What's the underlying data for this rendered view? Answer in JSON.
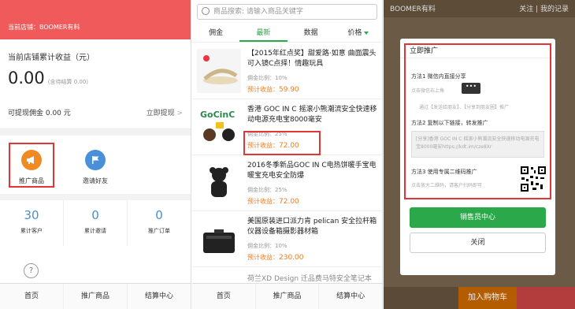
{
  "panel1": {
    "store_label": "当前店铺：BOOMER有料",
    "earn_label": "当前店铺累计收益（元）",
    "earn_amount": "0.00",
    "earn_note": "(含待结算 0.00)",
    "withdrawable": "可提现佣金 0.00 元",
    "withdraw_link": "立即提现",
    "withdraw_chevron": ">",
    "promote_label": "推广商品",
    "invite_label": "邀请好友",
    "promote_icon": "megaphone-icon",
    "invite_icon": "flag-icon",
    "stats": [
      {
        "num": "30",
        "label": "累计客户"
      },
      {
        "num": "0",
        "label": "累计邀请"
      },
      {
        "num": "0",
        "label": "推广订单"
      }
    ],
    "help_glyph": "?",
    "tabs": [
      "首页",
      "推广商品",
      "结算中心"
    ],
    "colors": {
      "header": "#f05a5a",
      "stat": "#4a90c8",
      "highlight": "#e23535"
    }
  },
  "panel2": {
    "search_placeholder": "商品搜索: 请输入商品关键字",
    "tabs": [
      "佣金",
      "最新",
      "数据",
      "价格"
    ],
    "active_tab": "最新",
    "items": [
      {
        "title": "【2015年红点奖】甜爱路·如意 曲面震头可入镜C点择！情趣玩具",
        "ratio": "佣金比例：10%",
        "income_label": "预计收益：",
        "income": "59.90"
      },
      {
        "title": "香港 GOC IN C 摇滚小熊潮流安全快速移动电源充电宝8000毫安",
        "ratio": "佣金比例：25%",
        "income_label": "预计收益：",
        "income": "72.00"
      },
      {
        "title": "2016冬季新品GOC IN C电热饼暖手宝电暖宝充电安全防爆",
        "ratio": "佣金比例：25%",
        "income_label": "预计收益：",
        "income": "72.00"
      },
      {
        "title": "美国原装进口派力肯 pelican 安全拉杆箱仪器设备箱摄影器材箱",
        "ratio": "佣金比例：10%",
        "income_label": "预计收益：",
        "income": "230.00"
      },
      {
        "title": "荷兰XD Design 迁品费马特安全笔记本双",
        "ratio": "",
        "income_label": "",
        "income": ""
      }
    ],
    "tabs_bottom": [
      "首页",
      "推广商品",
      "结算中心"
    ],
    "colors": {
      "accent": "#2aa84a",
      "income": "#f07a1e"
    }
  },
  "panel3": {
    "bg_title": "BOOMER有料",
    "bg_links": [
      "关注",
      "我的记录"
    ],
    "modal_title": "立即推广",
    "method1": "方法1 微信内直接分享",
    "method1_hint": "点击微信右上角",
    "more_glyph": "•••",
    "method1_hint2": "通过【发送给朋友】、【分享到朋友圈】推广",
    "method2": "方法2 复制以下链接，转发推广",
    "copy_text": "[分享]香港 GOC IN C 摇滚小熊潮流安全快速移动电源充电宝8000毫安https://kdt.im/cze8Xr",
    "method3": "方法3 使用专属二维码推广",
    "method3_hint": "点击放大二维码，请客户扫码即可",
    "btn_primary": "销售员中心",
    "btn_close": "关闭",
    "bottom_cart": "加入购物车",
    "colors": {
      "primary": "#2aa84a"
    }
  }
}
